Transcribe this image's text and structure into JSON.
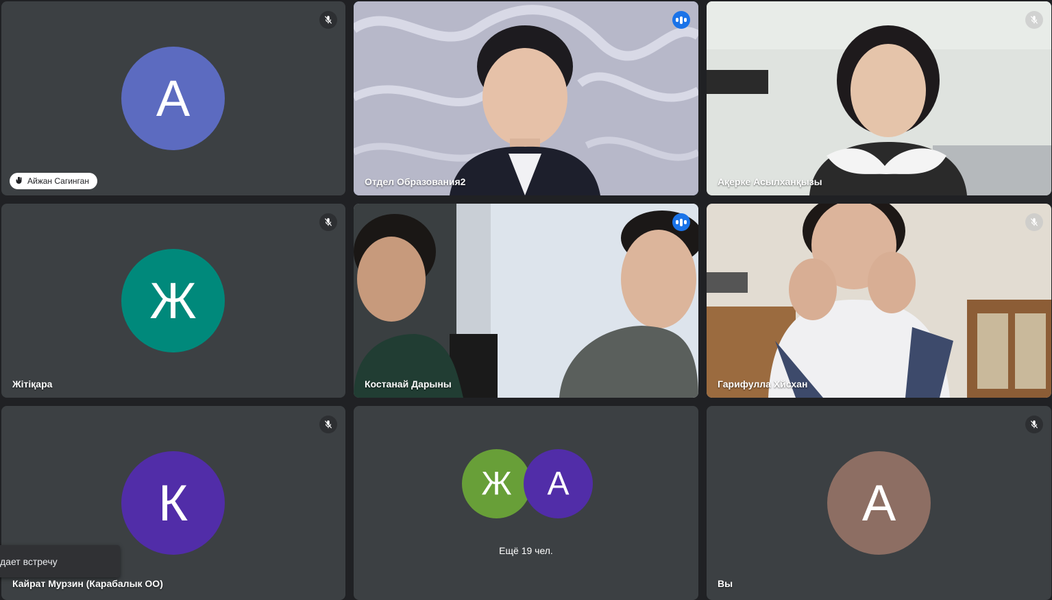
{
  "tiles": [
    {
      "name": "Айжан Сагинган",
      "avatar_letter": "А",
      "avatar_color": "#5c6bc0",
      "muted": true
    },
    {
      "name": "Отдел Образования2",
      "speaking": true
    },
    {
      "name": "Ақерке Асылханқызы",
      "muted": true
    },
    {
      "name": "Жітіқара",
      "avatar_letter": "Ж",
      "avatar_color": "#00897b",
      "muted": true
    },
    {
      "name": "Костанай Дарыны",
      "speaking": true
    },
    {
      "name": "Гарифулла Хйсхан",
      "muted": true
    },
    {
      "name": "Кайрат Мурзин (Карабалык ОО)",
      "avatar_letter": "К",
      "avatar_color": "#512da8",
      "muted": true
    },
    {
      "more_label": "Ещё 19 чел.",
      "letters": [
        "Ж",
        "А"
      ],
      "colors": [
        "#689f38",
        "#512da8"
      ]
    },
    {
      "name": "Вы",
      "avatar_letter": "А",
      "avatar_color": "#8d6e63",
      "muted": true
    }
  ],
  "toast": {
    "text": "дает встречу"
  }
}
